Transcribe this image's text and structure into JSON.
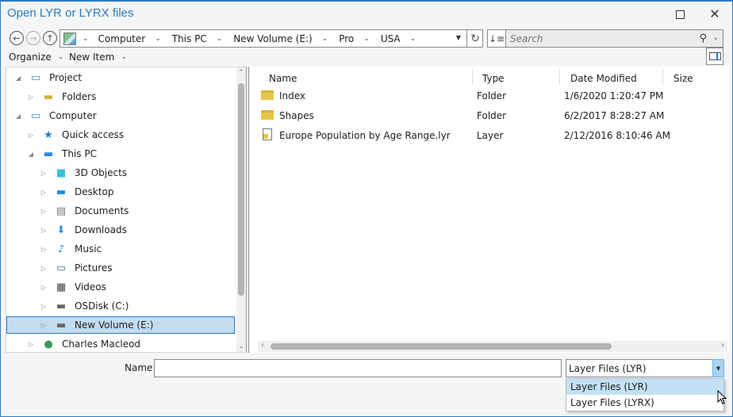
{
  "window": {
    "title": "Open LYR or LYRX files",
    "maximize_icon": "maximize-icon",
    "close_icon": "close-icon"
  },
  "nav": {
    "back_icon": "arrow-left-icon",
    "forward_icon": "arrow-right-icon",
    "up_icon": "arrow-up-icon",
    "breadcrumbs": [
      "Computer",
      "This PC",
      "New Volume (E:)",
      "Pro",
      "USA"
    ],
    "refresh_icon": "refresh-icon",
    "sort_icon": "sort-icon",
    "search_placeholder": "Search",
    "search_value": ""
  },
  "toolbar": {
    "organize": "Organize",
    "new_item": "New Item"
  },
  "tree": {
    "items": [
      {
        "label": "Project",
        "level": 0,
        "expanded": true,
        "icon": "project-icon"
      },
      {
        "label": "Folders",
        "level": 1,
        "expanded": false,
        "icon": "folders-icon"
      },
      {
        "label": "Computer",
        "level": 0,
        "expanded": true,
        "icon": "computer-icon"
      },
      {
        "label": "Quick access",
        "level": 1,
        "expanded": false,
        "icon": "star-icon"
      },
      {
        "label": "This PC",
        "level": 1,
        "expanded": true,
        "icon": "monitor-icon"
      },
      {
        "label": "3D Objects",
        "level": 2,
        "expanded": false,
        "icon": "cube-icon"
      },
      {
        "label": "Desktop",
        "level": 2,
        "expanded": false,
        "icon": "desktop-icon"
      },
      {
        "label": "Documents",
        "level": 2,
        "expanded": false,
        "icon": "documents-icon"
      },
      {
        "label": "Downloads",
        "level": 2,
        "expanded": false,
        "icon": "download-icon"
      },
      {
        "label": "Music",
        "level": 2,
        "expanded": false,
        "icon": "music-icon"
      },
      {
        "label": "Pictures",
        "level": 2,
        "expanded": false,
        "icon": "pictures-icon"
      },
      {
        "label": "Videos",
        "level": 2,
        "expanded": false,
        "icon": "videos-icon"
      },
      {
        "label": "OSDisk (C:)",
        "level": 2,
        "expanded": false,
        "icon": "drive-icon"
      },
      {
        "label": "New Volume (E:)",
        "level": 2,
        "expanded": false,
        "icon": "drive-icon",
        "selected": true
      },
      {
        "label": "Charles Macleod",
        "level": 1,
        "expanded": false,
        "icon": "user-icon"
      }
    ]
  },
  "list": {
    "columns": [
      "Name",
      "Type",
      "Date Modified",
      "Size"
    ],
    "rows": [
      {
        "name": "Index",
        "type": "Folder",
        "date": "1/6/2020 1:20:47 PM",
        "size": "",
        "icon": "folder-icon"
      },
      {
        "name": "Shapes",
        "type": "Folder",
        "date": "6/2/2017 8:28:27 AM",
        "size": "",
        "icon": "folder-icon"
      },
      {
        "name": "Europe Population by Age Range.lyr",
        "type": "Layer",
        "date": "2/12/2016 8:10:46 AM",
        "size": "",
        "icon": "layer-file-icon"
      }
    ]
  },
  "bottom": {
    "name_label": "Name",
    "name_value": "",
    "filter_selected": "Layer Files (LYR)",
    "filter_options": [
      "Layer Files (LYR)",
      "Layer Files (LYRX)"
    ],
    "hovered_option": 0
  },
  "colors": {
    "accent": "#2b7bc0",
    "selection": "#c3dcf0",
    "dropdown_hover": "#c3e1f6"
  }
}
